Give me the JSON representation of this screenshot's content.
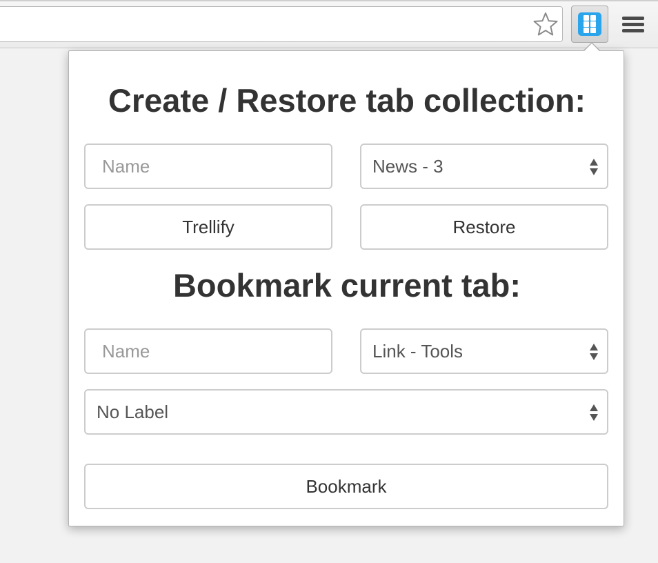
{
  "browser": {
    "star_icon": "star-outline-icon",
    "extension_icon": "grid-icon",
    "menu_icon": "hamburger-menu-icon",
    "accent_color": "#2aa4ea"
  },
  "collection": {
    "heading": "Create / Restore tab collection:",
    "name_placeholder": "Name",
    "name_value": "",
    "select_value": "News - 3",
    "trellify_label": "Trellify",
    "restore_label": "Restore"
  },
  "bookmark": {
    "heading": "Bookmark current tab:",
    "name_placeholder": "Name",
    "name_value": "",
    "link_select_value": "Link - Tools",
    "label_select_value": "No Label",
    "bookmark_label": "Bookmark"
  }
}
